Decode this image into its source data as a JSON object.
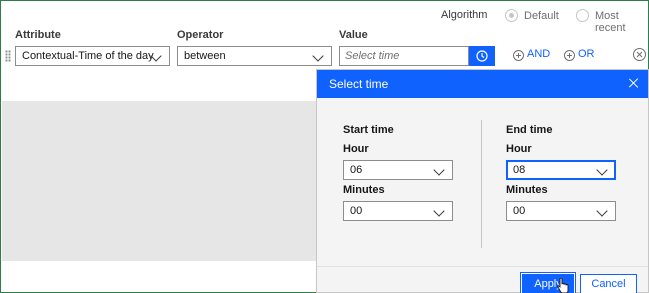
{
  "algorithm": {
    "label": "Algorithm",
    "options": [
      {
        "label": "Default",
        "selected": true
      },
      {
        "label": "Most recent",
        "selected": false
      }
    ]
  },
  "columns": {
    "attribute": "Attribute",
    "operator": "Operator",
    "value": "Value"
  },
  "row": {
    "attribute_value": "Contextual-Time of the day",
    "operator_value": "between",
    "value_placeholder": "Select time",
    "and_label": "AND",
    "or_label": "OR"
  },
  "dialog": {
    "title": "Select time",
    "start": {
      "title": "Start time",
      "hour_label": "Hour",
      "hour_value": "06",
      "minutes_label": "Minutes",
      "minutes_value": "00"
    },
    "end": {
      "title": "End time",
      "hour_label": "Hour",
      "hour_value": "08",
      "minutes_label": "Minutes",
      "minutes_value": "00"
    },
    "apply_label": "Apply",
    "cancel_label": "Cancel"
  },
  "colors": {
    "accent": "#0f62fe",
    "frame_border": "#2d7e4b",
    "dialog_bg": "#f4f4f4",
    "overlay_grey": "#e6e6e6"
  },
  "icons": [
    "drag-handle-icon",
    "chevron-down-icon",
    "clock-icon",
    "add-icon",
    "close-icon",
    "remove-icon",
    "hand-cursor-icon"
  ]
}
